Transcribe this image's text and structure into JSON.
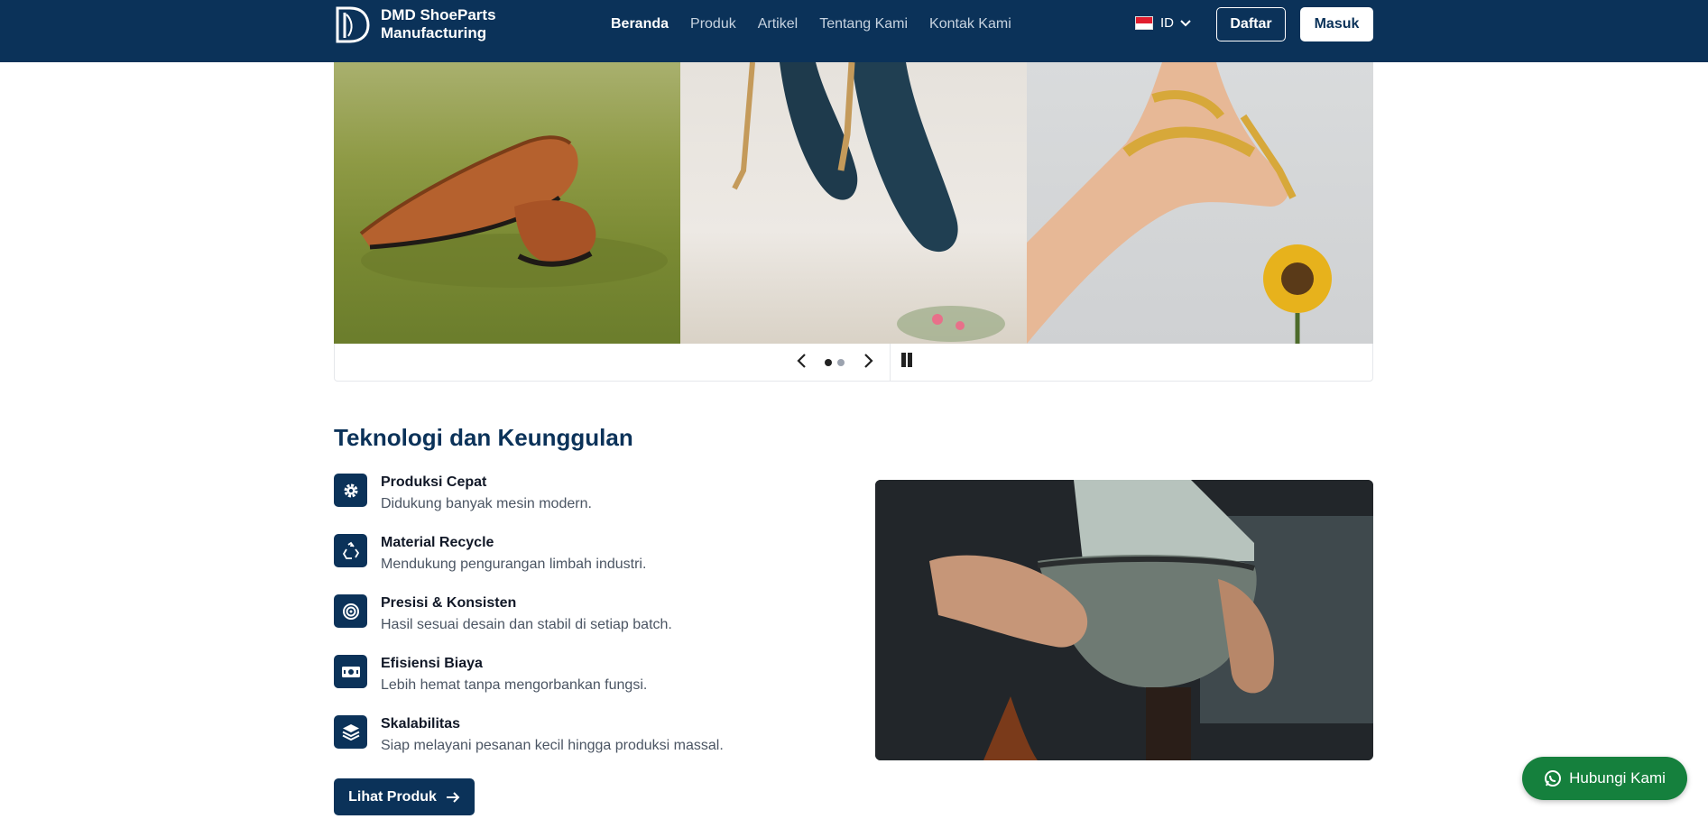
{
  "brand": {
    "name_line1": "DMD ShoeParts",
    "name_line2": "Manufacturing"
  },
  "nav": {
    "items": [
      {
        "label": "Beranda",
        "active": true
      },
      {
        "label": "Produk",
        "active": false
      },
      {
        "label": "Artikel",
        "active": false
      },
      {
        "label": "Tentang Kami",
        "active": false
      },
      {
        "label": "Kontak Kami",
        "active": false
      }
    ],
    "language": "ID",
    "register_label": "Daftar",
    "login_label": "Masuk"
  },
  "carousel": {
    "slides": [
      "slide-1",
      "slide-2",
      "slide-3"
    ],
    "pages": 2,
    "current_page": 1
  },
  "technology": {
    "title": "Teknologi dan Keunggulan",
    "features": [
      {
        "icon": "gear-icon",
        "title": "Produksi Cepat",
        "desc": "Didukung banyak mesin modern."
      },
      {
        "icon": "recycle-icon",
        "title": "Material Recycle",
        "desc": "Mendukung pengurangan limbah industri."
      },
      {
        "icon": "target-icon",
        "title": "Presisi & Konsisten",
        "desc": "Hasil sesuai desain dan stabil di setiap batch."
      },
      {
        "icon": "money-icon",
        "title": "Efisiensi Biaya",
        "desc": "Lebih hemat tanpa mengorbankan fungsi."
      },
      {
        "icon": "layers-icon",
        "title": "Skalabilitas",
        "desc": "Siap melayani pesanan kecil hingga produksi massal."
      }
    ],
    "cta_label": "Lihat Produk"
  },
  "contact": {
    "label": "Hubungi Kami"
  },
  "colors": {
    "primary": "#0b3259",
    "whatsapp": "#15803d"
  }
}
